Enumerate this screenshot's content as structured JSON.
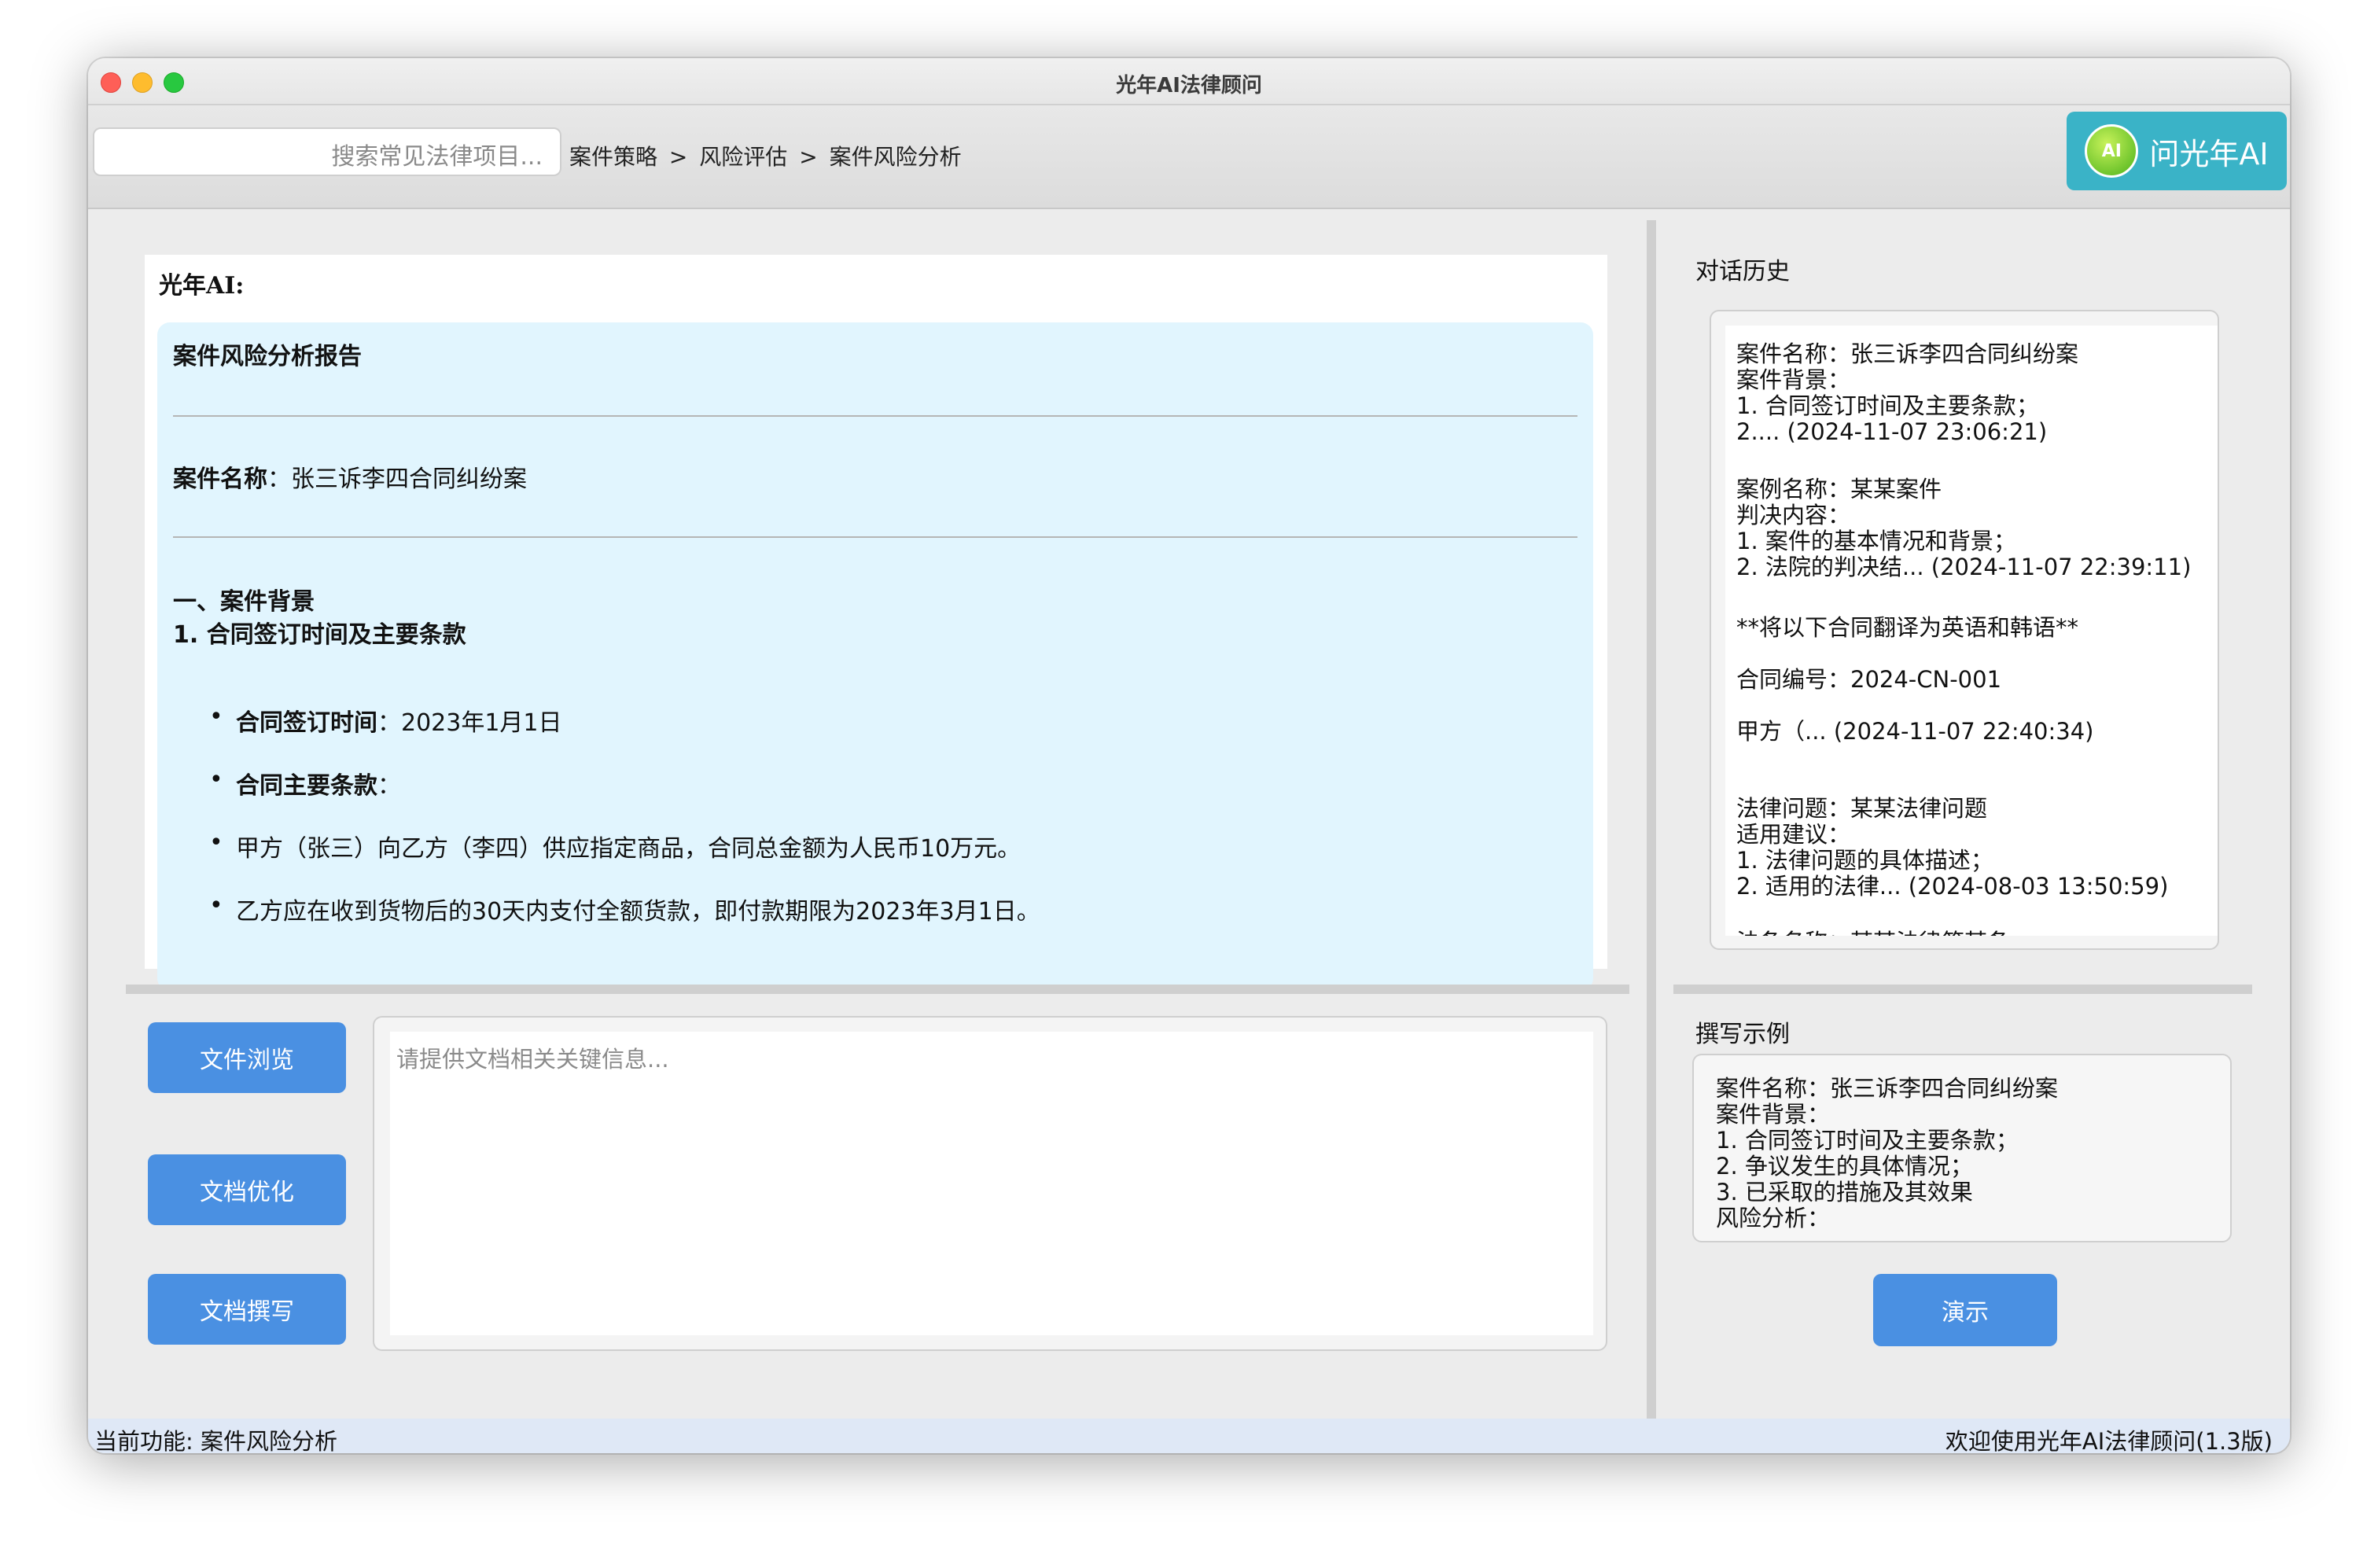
{
  "window": {
    "title": "光年AI法律顾问"
  },
  "toolbar": {
    "search_placeholder": "搜索常见法律项目...",
    "breadcrumb": [
      "案件策略",
      ">",
      "风险评估",
      ">",
      "案件风险分析"
    ],
    "ask_button_label": "问光年AI",
    "ask_icon_text": "AI"
  },
  "chat": {
    "speaker": "光年AI:",
    "report": {
      "title": "案件风险分析报告",
      "case_name_label": "案件名称",
      "case_name_value": "：张三诉李四合同纠纷案",
      "section1": "一、案件背景",
      "subsection1": "1. 合同签订时间及主要条款",
      "bullets": [
        {
          "label": "合同签订时间",
          "value": "：2023年1月1日"
        },
        {
          "label": "合同主要条款",
          "value": "："
        },
        {
          "label": "",
          "value": "甲方（张三）向乙方（李四）供应指定商品，合同总金额为人民币10万元。"
        },
        {
          "label": "",
          "value": "乙方应在收到货物后的30天内支付全额货款，即付款期限为2023年3月1日。"
        }
      ]
    }
  },
  "actions": {
    "browse": "文件浏览",
    "optimize": "文档优化",
    "compose": "文档撰写"
  },
  "editor": {
    "placeholder": "请提供文档相关关键信息..."
  },
  "history": {
    "label": "对话历史",
    "items": [
      "案件名称：张三诉李四合同纠纷案\n案件背景：\n1. 合同签订时间及主要条款；\n2.... (2024-11-07 23:06:21)",
      "案例名称：某某案件\n判决内容：\n1. 案件的基本情况和背景；\n2. 法院的判决结... (2024-11-07 22:39:11)",
      "**将以下合同翻译为英语和韩语**\n\n合同编号：2024-CN-001\n\n甲方（... (2024-11-07 22:40:34)",
      "法律问题：某某法律问题\n适用建议：\n1. 法律问题的具体描述；\n2. 适用的法律... (2024-08-03 13:50:59)",
      "法条名称：某某法律第某条"
    ]
  },
  "example": {
    "label": "撰写示例",
    "text": "案件名称：张三诉李四合同纠纷案\n案件背景：\n1. 合同签订时间及主要条款；\n2. 争议发生的具体情况；\n3. 已采取的措施及其效果\n风险分析：",
    "demo_button": "演示"
  },
  "status": {
    "left": "当前功能: 案件风险分析",
    "right": "欢迎使用光年AI法律顾问(1.3版)"
  }
}
